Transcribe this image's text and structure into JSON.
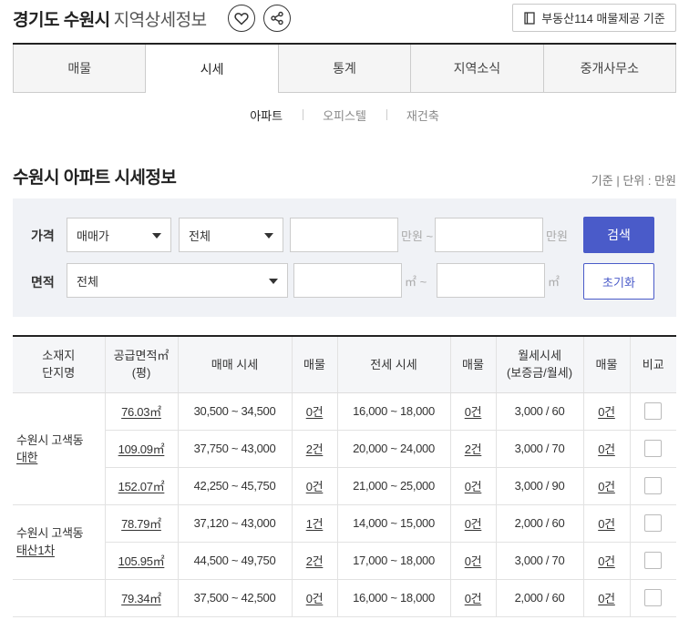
{
  "header": {
    "title_main": "경기도 수원시",
    "title_sub": "지역상세정보",
    "source_label": "부동산114 매물제공 기준",
    "icons": {
      "favorite": "heart-icon",
      "share": "share-icon",
      "source": "document-icon"
    }
  },
  "tabs": [
    {
      "label": "매물",
      "active": false
    },
    {
      "label": "시세",
      "active": true
    },
    {
      "label": "통계",
      "active": false
    },
    {
      "label": "지역소식",
      "active": false
    },
    {
      "label": "중개사무소",
      "active": false
    }
  ],
  "subtabs": [
    {
      "label": "아파트",
      "active": true
    },
    {
      "label": "오피스텔",
      "active": false
    },
    {
      "label": "재건축",
      "active": false
    }
  ],
  "section": {
    "title": "수원시 아파트 시세정보",
    "unit_note": "기준 | 단위 : 만원"
  },
  "filter": {
    "price_label": "가격",
    "price_type": "매매가",
    "price_scope": "전체",
    "price_min": "",
    "price_max": "",
    "price_min_unit": "만원 ~",
    "price_max_unit": "만원",
    "area_label": "면적",
    "area_type": "전체",
    "area_min": "",
    "area_max": "",
    "area_min_unit": "㎡ ~",
    "area_max_unit": "㎡",
    "search_label": "검색",
    "reset_label": "초기화"
  },
  "table": {
    "headers": {
      "location": [
        "소재지",
        "단지명"
      ],
      "area": [
        "공급면적㎡",
        "(평)"
      ],
      "sale": "매매 시세",
      "sale_count": "매물",
      "jeonse": "전세 시세",
      "jeonse_count": "매물",
      "monthly": [
        "월세시세",
        "(보증금/월세)"
      ],
      "monthly_count": "매물",
      "compare": "비교"
    },
    "groups": [
      {
        "region": "수원시 고색동",
        "complex": "대한",
        "rows": [
          {
            "area": "76.03㎡",
            "sale": "30,500 ~ 34,500",
            "sale_count": "0건",
            "jeonse": "16,000 ~ 18,000",
            "jeonse_count": "0건",
            "monthly": "3,000 / 60",
            "monthly_count": "0건"
          },
          {
            "area": "109.09㎡",
            "sale": "37,750 ~ 43,000",
            "sale_count": "2건",
            "jeonse": "20,000 ~ 24,000",
            "jeonse_count": "2건",
            "monthly": "3,000 / 70",
            "monthly_count": "0건"
          },
          {
            "area": "152.07㎡",
            "sale": "42,250 ~ 45,750",
            "sale_count": "0건",
            "jeonse": "21,000 ~ 25,000",
            "jeonse_count": "0건",
            "monthly": "3,000 / 90",
            "monthly_count": "0건"
          }
        ]
      },
      {
        "region": "수원시 고색동",
        "complex": "태산1차",
        "rows": [
          {
            "area": "78.79㎡",
            "sale": "37,120 ~ 43,000",
            "sale_count": "1건",
            "jeonse": "14,000 ~ 15,000",
            "jeonse_count": "0건",
            "monthly": "2,000 / 60",
            "monthly_count": "0건"
          },
          {
            "area": "105.95㎡",
            "sale": "44,500 ~ 49,750",
            "sale_count": "2건",
            "jeonse": "17,000 ~ 18,000",
            "jeonse_count": "0건",
            "monthly": "3,000 / 70",
            "monthly_count": "0건"
          }
        ]
      },
      {
        "region": "",
        "complex": "",
        "rows": [
          {
            "area": "79.34㎡",
            "sale": "37,500 ~ 42,500",
            "sale_count": "0건",
            "jeonse": "16,000 ~ 18,000",
            "jeonse_count": "0건",
            "monthly": "2,000 / 60",
            "monthly_count": "0건"
          }
        ]
      }
    ]
  },
  "colors": {
    "primary": "#4a5bc9",
    "filter_bg": "#f0f2f6",
    "header_bg": "#f5f6f8"
  }
}
